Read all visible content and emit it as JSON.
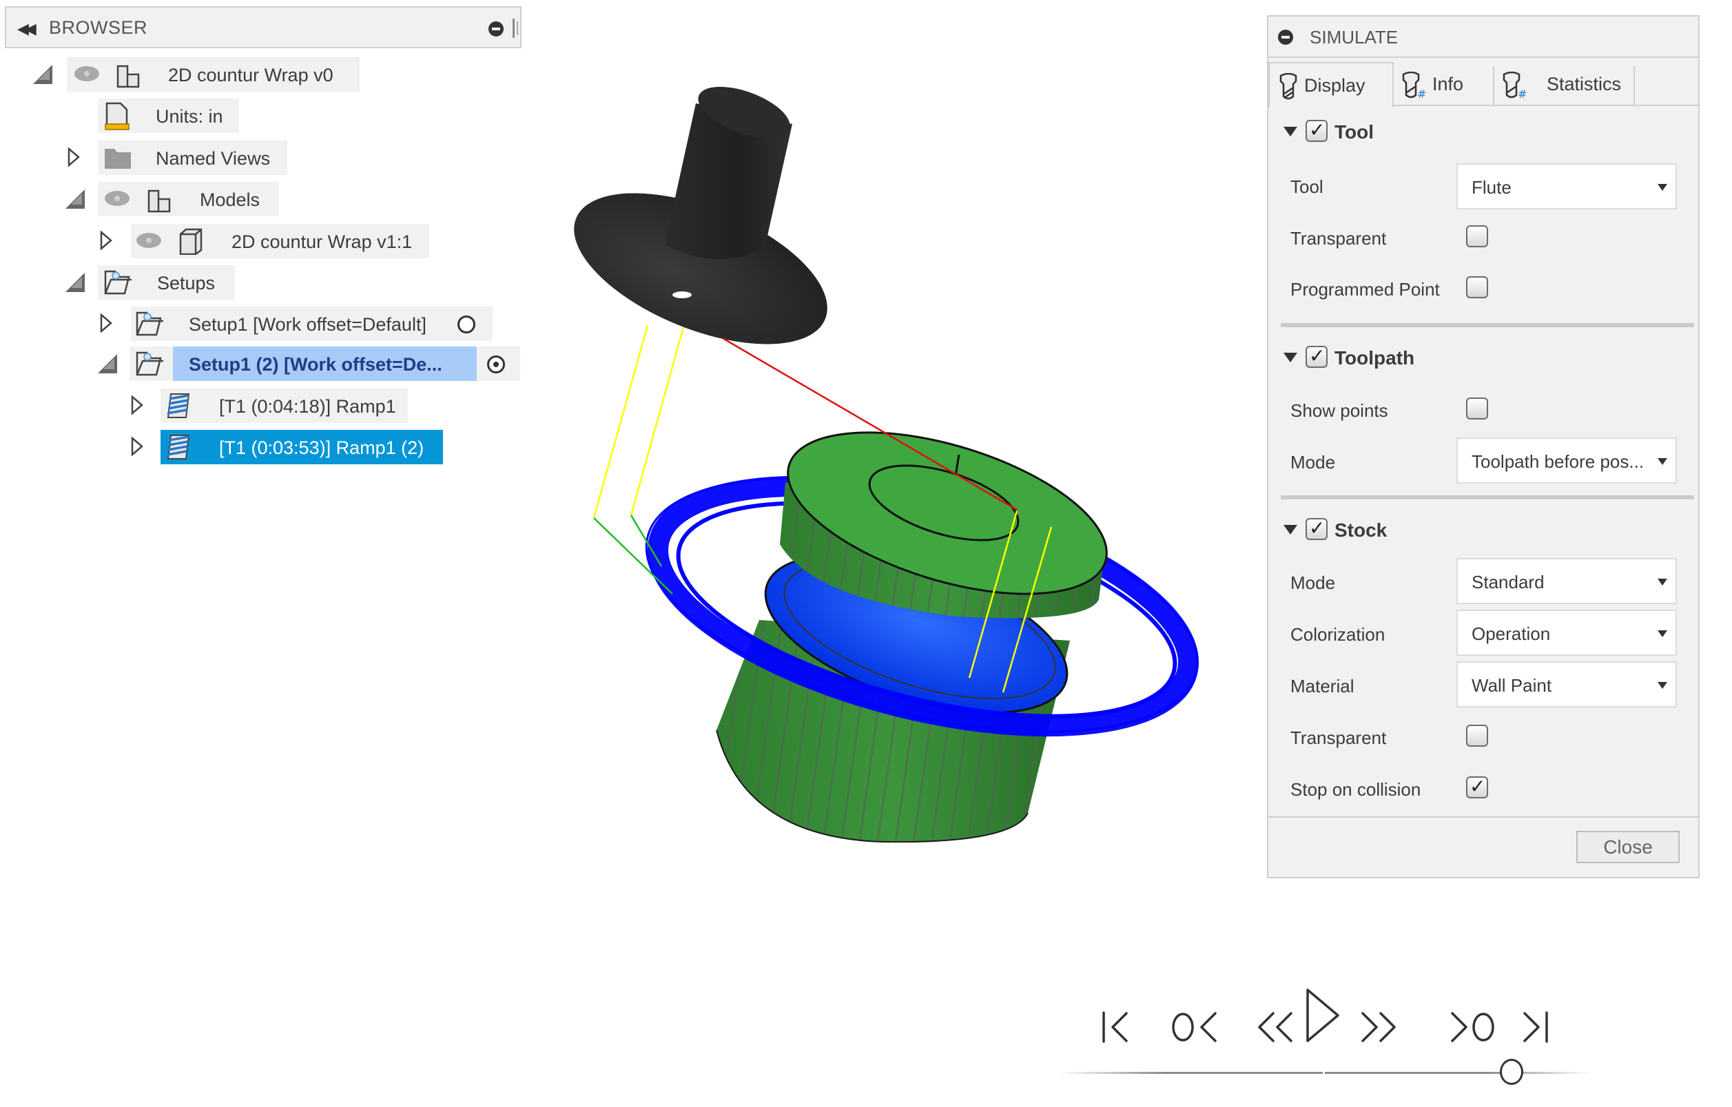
{
  "browser": {
    "title": "BROWSER",
    "items": [
      {
        "label": "2D countur Wrap v0",
        "icon": "component-icon",
        "expanded": true,
        "visible": true
      },
      {
        "label": "Units: in",
        "icon": "units-document-icon"
      },
      {
        "label": "Named Views",
        "icon": "folder-icon",
        "expanded": false
      },
      {
        "label": "Models",
        "icon": "component-icon",
        "expanded": true,
        "visible": true
      },
      {
        "label": "2D countur Wrap v1:1",
        "icon": "body-icon",
        "expanded": false,
        "visible": true
      },
      {
        "label": "Setups",
        "icon": "setup-folder-icon",
        "expanded": true
      },
      {
        "label": "Setup1 [Work offset=Default]",
        "icon": "setup-icon",
        "expanded": false,
        "active": false
      },
      {
        "label": "Setup1 (2) [Work offset=De...",
        "icon": "setup-icon",
        "expanded": true,
        "active": true
      },
      {
        "label": "[T1 (0:04:18)] Ramp1",
        "icon": "ramp-toolpath-icon",
        "expanded": false
      },
      {
        "label": "[T1 (0:03:53)] Ramp1 (2)",
        "icon": "ramp-toolpath-icon",
        "expanded": false,
        "selected": true
      }
    ]
  },
  "simulate": {
    "title": "SIMULATE",
    "tabs": [
      {
        "label": "Display",
        "active": true
      },
      {
        "label": "Info",
        "active": false
      },
      {
        "label": "Statistics",
        "active": false
      }
    ],
    "sections": {
      "tool": {
        "label": "Tool",
        "checked": true,
        "tool_label": "Tool",
        "tool_value": "Flute",
        "transparent_label": "Transparent",
        "transparent": false,
        "programmed_point_label": "Programmed Point",
        "programmed_point": false
      },
      "toolpath": {
        "label": "Toolpath",
        "checked": true,
        "show_points_label": "Show points",
        "show_points": false,
        "mode_label": "Mode",
        "mode_value": "Toolpath before pos..."
      },
      "stock": {
        "label": "Stock",
        "checked": true,
        "mode_label": "Mode",
        "mode_value": "Standard",
        "colorization_label": "Colorization",
        "colorization_value": "Operation",
        "material_label": "Material",
        "material_value": "Wall Paint",
        "transparent_label": "Transparent",
        "transparent": false,
        "stop_on_collision_label": "Stop on collision",
        "stop_on_collision": true
      }
    },
    "close_label": "Close"
  },
  "playback": {
    "buttons": [
      "go-to-start",
      "previous-operation",
      "step-back",
      "play",
      "step-forward",
      "next-operation",
      "go-to-end"
    ],
    "progress": 0.85
  },
  "colors": {
    "selection_blue": "#0696d7",
    "active_setup_highlight": "#a8ccf8",
    "stock_green": "#3f9e3f",
    "toolpath_blue": "#0000ff",
    "tool_black": "#262829",
    "rapid_yellow": "#ffff00",
    "lead_green": "#22bb22",
    "plunge_red": "#dd1111"
  }
}
